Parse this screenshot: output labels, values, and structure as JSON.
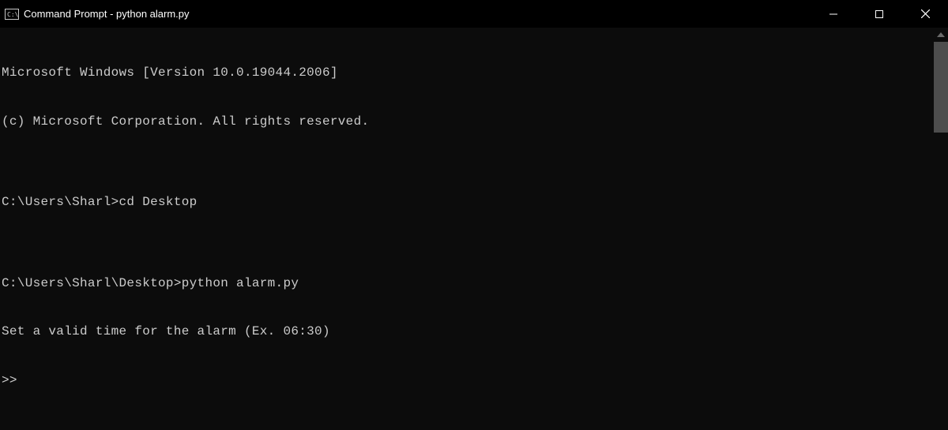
{
  "titlebar": {
    "title": "Command Prompt - python  alarm.py"
  },
  "terminal": {
    "lines": [
      "Microsoft Windows [Version 10.0.19044.2006]",
      "(c) Microsoft Corporation. All rights reserved.",
      "",
      "C:\\Users\\Sharl>cd Desktop",
      "",
      "C:\\Users\\Sharl\\Desktop>python alarm.py",
      "Set a valid time for the alarm (Ex. 06:30)",
      ">>"
    ]
  }
}
